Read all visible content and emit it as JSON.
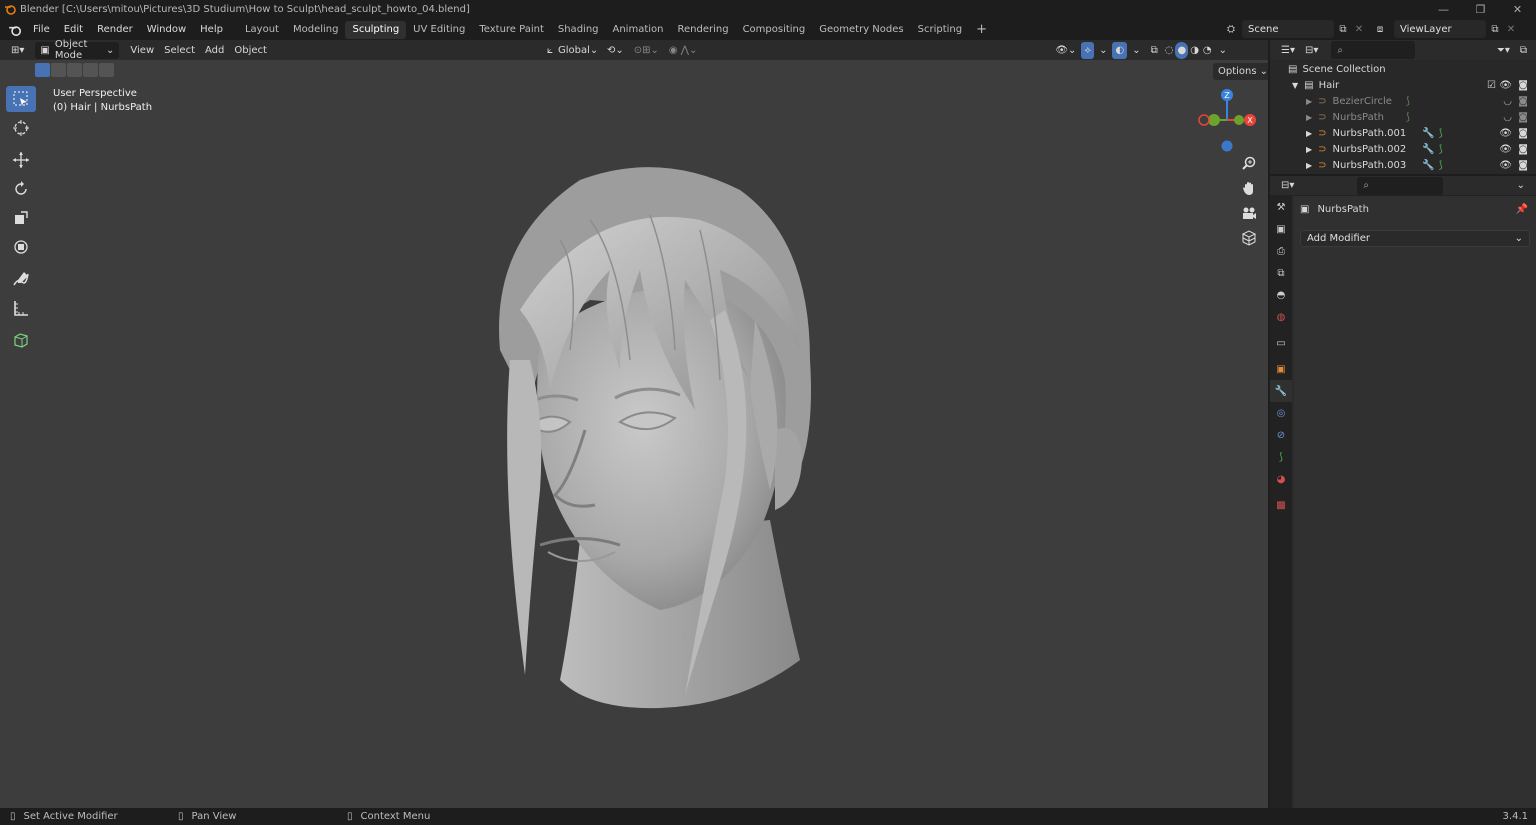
{
  "window": {
    "title": "Blender [C:\\Users\\mitou\\Pictures\\3D Studium\\How to Sculpt\\head_sculpt_howto_04.blend]"
  },
  "menu": [
    "File",
    "Edit",
    "Render",
    "Window",
    "Help"
  ],
  "workspaces": [
    "Layout",
    "Modeling",
    "Sculpting",
    "UV Editing",
    "Texture Paint",
    "Shading",
    "Animation",
    "Rendering",
    "Compositing",
    "Geometry Nodes",
    "Scripting"
  ],
  "active_workspace": "Sculpting",
  "scene": "Scene",
  "view_layer": "ViewLayer",
  "viewport_header": {
    "mode": "Object Mode",
    "menus": [
      "View",
      "Select",
      "Add",
      "Object"
    ],
    "orientation": "Global",
    "options": "Options"
  },
  "viewport": {
    "perspective": "User Perspective",
    "object_info": "(0) Hair | NurbsPath",
    "gizmo": {
      "z": "Z",
      "x": "X"
    }
  },
  "outliner": {
    "root": "Scene Collection",
    "collection": "Hair",
    "items": [
      {
        "name": "BezierCircle",
        "dim": true
      },
      {
        "name": "NurbsPath",
        "dim": true
      },
      {
        "name": "NurbsPath.001",
        "dim": false
      },
      {
        "name": "NurbsPath.002",
        "dim": false
      },
      {
        "name": "NurbsPath.003",
        "dim": false
      }
    ]
  },
  "properties": {
    "object_name": "NurbsPath",
    "add_modifier": "Add Modifier"
  },
  "statusbar": {
    "left": "Set Active Modifier",
    "middle": "Pan View",
    "right": "Context Menu",
    "version": "3.4.1"
  },
  "colors": {
    "accent": "#4772b3",
    "axis_x": "#e8443a",
    "axis_y": "#6ba32d",
    "axis_z": "#3a84e0",
    "curve_orange": "#e08a3a",
    "curve_green": "#52b04f"
  }
}
